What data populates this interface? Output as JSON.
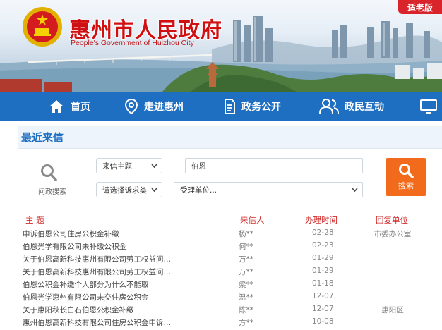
{
  "header": {
    "title": "惠州市人民政府",
    "subtitle": "People's Government of Huizhou City",
    "elder_mode_label": "适老版",
    "emblem_icon": "national-emblem-icon"
  },
  "nav": {
    "items": [
      {
        "label": "首页",
        "icon": "home-icon"
      },
      {
        "label": "走进惠州",
        "icon": "location-pin-icon"
      },
      {
        "label": "政务公开",
        "icon": "document-icon"
      },
      {
        "label": "政民互动",
        "icon": "people-icon"
      },
      {
        "label": "",
        "icon": "monitor-icon"
      }
    ]
  },
  "section": {
    "title": "最近来信"
  },
  "search": {
    "caption": "问政搜索",
    "topic_select": "来信主题",
    "keyword": "伯恩",
    "complaint_type_select": "请选择诉求类",
    "unit_select": "受理单位...",
    "button_label": "搜索"
  },
  "table": {
    "headers": {
      "subject": "主 题",
      "sender": "来信人",
      "date": "办理时间",
      "unit": "回复单位"
    },
    "rows": [
      {
        "subject": "申诉伯恩公司住房公积金补缴",
        "sender": "杨**",
        "date": "02-28",
        "unit": "市委办公室"
      },
      {
        "subject": "伯恩光学有限公司未补缴公积金",
        "sender": "何**",
        "date": "02-23",
        "unit": ""
      },
      {
        "subject": "关于伯恩高新科技惠州有限公司劳工权益问…",
        "sender": "万**",
        "date": "01-29",
        "unit": ""
      },
      {
        "subject": "关于伯恩高新科技惠州有限公司劳工权益问…",
        "sender": "万**",
        "date": "01-29",
        "unit": ""
      },
      {
        "subject": "伯恩公积金补缴个人部分为什么不能取",
        "sender": "梁**",
        "date": "01-18",
        "unit": ""
      },
      {
        "subject": "伯恩光学惠州有限公司未交住房公积金",
        "sender": "温**",
        "date": "12-07",
        "unit": ""
      },
      {
        "subject": "关于惠阳秋长白石伯恩公积金补缴",
        "sender": "陈**",
        "date": "12-07",
        "unit": "惠阳区"
      },
      {
        "subject": "惠州伯恩高新科技有限公司住房公积金申诉…",
        "sender": "方**",
        "date": "10-08",
        "unit": ""
      }
    ]
  },
  "colors": {
    "brand_red": "#d00f12",
    "nav_blue": "#1e6fc2",
    "search_orange": "#f26a1b",
    "header_red": "#d02a2a"
  }
}
